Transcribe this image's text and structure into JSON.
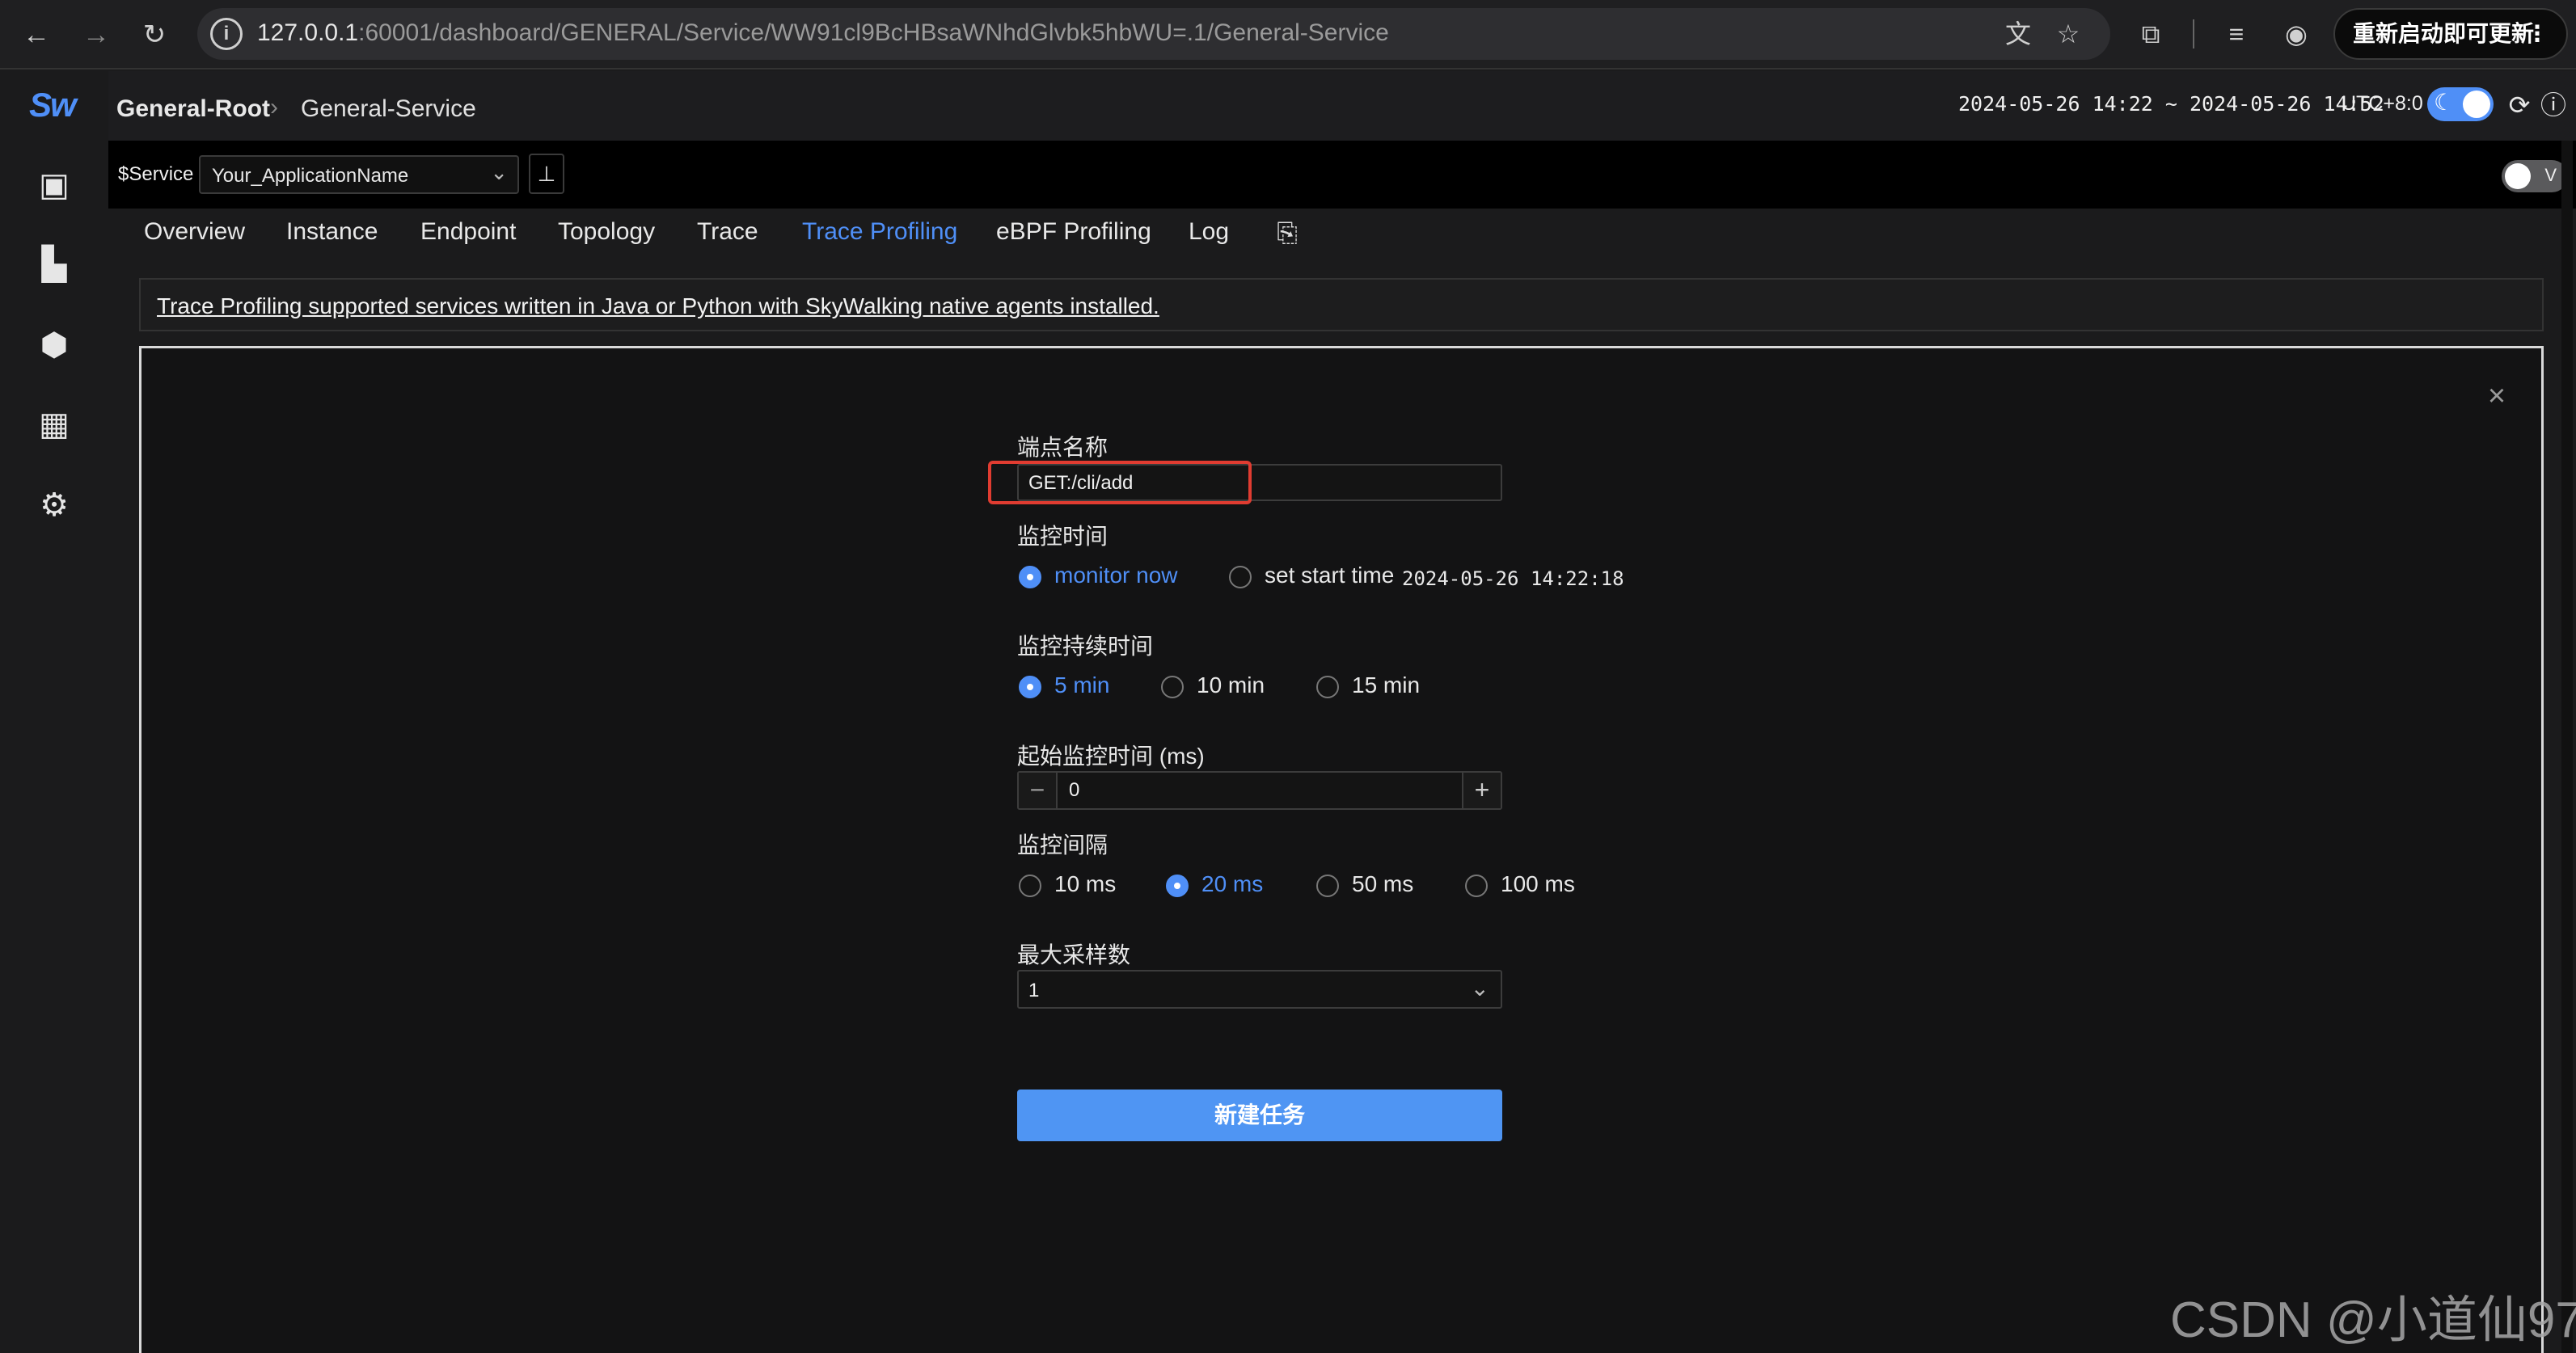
{
  "browser": {
    "url_host": "127.0.0.1",
    "url_rest": ":60001/dashboard/GENERAL/Service/WW91cl9BcHBsaWNhdGlvbk5hbWU=.1/General-Service",
    "update_label": "重新启动即可更新",
    "kebab": "⋮",
    "icons": [
      "back-arrow-icon",
      "forward-arrow-icon",
      "reload-icon",
      "site-info-icon",
      "translate-icon",
      "star-icon",
      "extensions-icon",
      "media-queue-icon",
      "profile-icon"
    ]
  },
  "sidebar": {
    "logo": "Sw",
    "icons": [
      "dashboard-grid-icon",
      "chart-icon",
      "alert-shield-icon",
      "add-widget-icon",
      "settings-gear-icon"
    ]
  },
  "header": {
    "breadcrumb_root": "General-Root",
    "breadcrumb_sep": "›",
    "breadcrumb_leaf": "General-Service",
    "time_range": "2024-05-26 14:22 ~ 2024-05-26 14:52",
    "timezone": "UTC+8:0",
    "dark_mode": true
  },
  "service_bar": {
    "label": "$Service",
    "selected": "Your_ApplicationName",
    "v_toggle_label": "V"
  },
  "tabs": [
    {
      "label": "Overview",
      "active": false
    },
    {
      "label": "Instance",
      "active": false
    },
    {
      "label": "Endpoint",
      "active": false
    },
    {
      "label": "Topology",
      "active": false
    },
    {
      "label": "Trace",
      "active": false
    },
    {
      "label": "Trace Profiling",
      "active": true
    },
    {
      "label": "eBPF Profiling",
      "active": false
    },
    {
      "label": "Log",
      "active": false
    }
  ],
  "notice": "Trace Profiling supported services written in Java or Python with SkyWalking native agents installed.",
  "form": {
    "endpoint_label": "端点名称",
    "endpoint_value": "GET:/cli/add",
    "monitor_time_label": "监控时间",
    "monitor_time_options": [
      "monitor now",
      "set start time"
    ],
    "monitor_time_selected": "monitor now",
    "start_time_value": "2024-05-26 14:22:18",
    "duration_label": "监控持续时间",
    "duration_options": [
      "5 min",
      "10 min",
      "15 min"
    ],
    "duration_selected": "5 min",
    "min_threshold_label": "起始监控时间 (ms)",
    "min_threshold_value": "0",
    "minus": "−",
    "plus": "+",
    "interval_label": "监控间隔",
    "interval_options": [
      "10 ms",
      "20 ms",
      "50 ms",
      "100 ms"
    ],
    "interval_selected": "20 ms",
    "max_sampling_label": "最大采样数",
    "max_sampling_value": "1",
    "submit_label": "新建任务",
    "close": "×"
  },
  "colors": {
    "accent": "#4f8ff7",
    "highlight": "#e03c31",
    "background": "#131314"
  },
  "watermark": "CSDN @小道仙97"
}
